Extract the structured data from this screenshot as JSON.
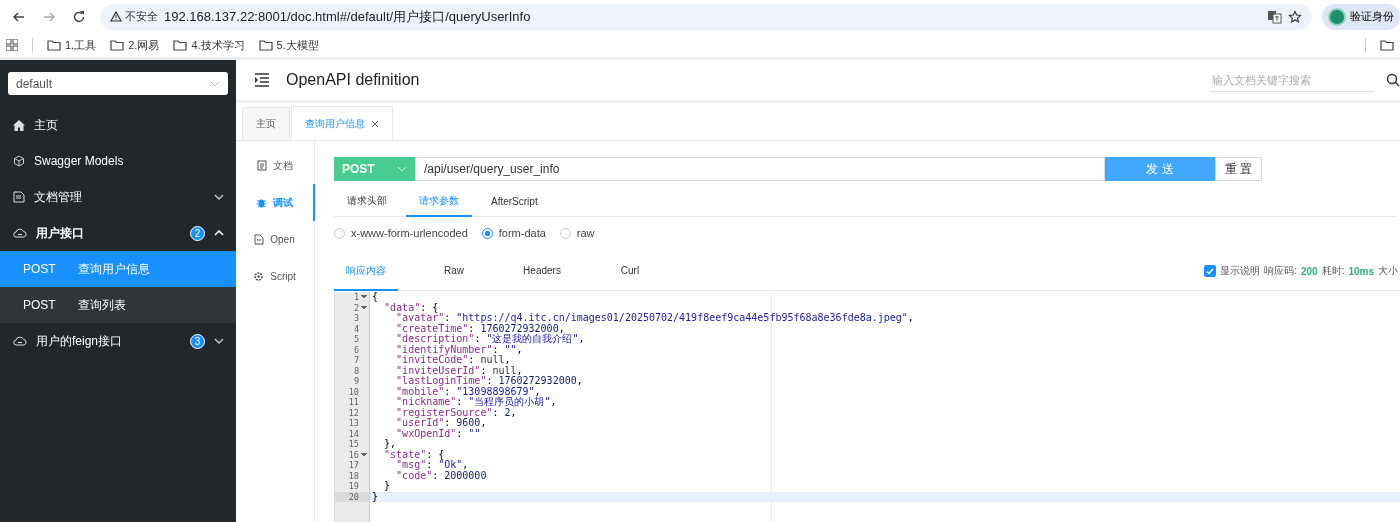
{
  "browser": {
    "security_label": "不安全",
    "url": "192.168.137.22:8001/doc.html#/default/用户接口/queryUserInfo",
    "profile_button": "验证身份",
    "bookmarks": [
      {
        "label": "1.工具"
      },
      {
        "label": "2.网易"
      },
      {
        "label": "4.技术学习"
      },
      {
        "label": "5.大模型"
      }
    ]
  },
  "sidebar": {
    "group_select": "default",
    "items": [
      {
        "kind": "item",
        "label": "主页"
      },
      {
        "kind": "item",
        "label": "Swagger Models"
      },
      {
        "kind": "group",
        "label": "文档管理",
        "expanded": false
      },
      {
        "kind": "group",
        "label": "用户接口",
        "badge": "2",
        "expanded": true,
        "children": [
          {
            "method": "POST",
            "label": "查询用户信息",
            "selected": true
          },
          {
            "method": "POST",
            "label": "查询列表",
            "selected": false
          }
        ]
      },
      {
        "kind": "group",
        "label": "用户的feign接口",
        "badge": "3",
        "expanded": false
      }
    ]
  },
  "header": {
    "title": "OpenAPI definition",
    "search": {
      "placeholder": "输入文档关键字搜索"
    }
  },
  "page_tabs": [
    {
      "label": "主页",
      "selected": false,
      "closable": false
    },
    {
      "label": "查询用户信息",
      "selected": true,
      "closable": true
    }
  ],
  "side_tabs": [
    {
      "label": "文档",
      "selected": false
    },
    {
      "label": "调试",
      "selected": true
    },
    {
      "label": "Open",
      "selected": false
    },
    {
      "label": "Script",
      "selected": false
    }
  ],
  "request": {
    "method": "POST",
    "url": "/api/user/query_user_info",
    "send_button": "发 送",
    "reset_button": "重 置"
  },
  "request_tabs": [
    {
      "label": "请求头部",
      "selected": false
    },
    {
      "label": "请求参数",
      "selected": true
    },
    {
      "label": "AfterScript",
      "selected": false
    }
  ],
  "body_types": [
    {
      "label": "x-www-form-urlencoded",
      "selected": false
    },
    {
      "label": "form-data",
      "selected": true
    },
    {
      "label": "raw",
      "selected": false
    }
  ],
  "response_tabs": [
    {
      "label": "响应内容",
      "selected": true
    },
    {
      "label": "Raw",
      "selected": false
    },
    {
      "label": "Headers",
      "selected": false
    },
    {
      "label": "Curl",
      "selected": false
    }
  ],
  "show_description": {
    "label": "显示说明",
    "checked": true
  },
  "response_status": [
    {
      "label": "响应码:",
      "value": "200"
    },
    {
      "label": "耗时:",
      "value": "10ms"
    },
    {
      "label": "大小"
    }
  ],
  "code_lines": [
    {
      "number": "1",
      "text": "{",
      "foldable": true,
      "active": false
    },
    {
      "number": "2",
      "text": "  \"data\": {",
      "foldable": true,
      "active": false
    },
    {
      "number": "3",
      "text": "    \"avatar\": \"https://q4.itc.cn/images01/20250702/419f8eef9ca44e5fb95f68a8e36fde8a.jpeg\",",
      "foldable": false,
      "active": false
    },
    {
      "number": "4",
      "text": "    \"createTime\": 1760272932000,",
      "foldable": false,
      "active": false
    },
    {
      "number": "5",
      "text": "    \"description\": \"这是我的自我介绍\",",
      "foldable": false,
      "active": false
    },
    {
      "number": "6",
      "text": "    \"identifyNumber\": \"\",",
      "foldable": false,
      "active": false
    },
    {
      "number": "7",
      "text": "    \"inviteCode\": null,",
      "foldable": false,
      "active": false
    },
    {
      "number": "8",
      "text": "    \"inviteUserId\": null,",
      "foldable": false,
      "active": false
    },
    {
      "number": "9",
      "text": "    \"lastLoginTime\": 1760272932000,",
      "foldable": false,
      "active": false
    },
    {
      "number": "10",
      "text": "    \"mobile\": \"13098898679\",",
      "foldable": false,
      "active": false
    },
    {
      "number": "11",
      "text": "    \"nickname\": \"当程序员的小胡\",",
      "foldable": false,
      "active": false
    },
    {
      "number": "12",
      "text": "    \"registerSource\": 2,",
      "foldable": false,
      "active": false
    },
    {
      "number": "13",
      "text": "    \"userId\": 9600,",
      "foldable": false,
      "active": false
    },
    {
      "number": "14",
      "text": "    \"wxOpenId\": \"\"",
      "foldable": false,
      "active": false
    },
    {
      "number": "15",
      "text": "  },",
      "foldable": false,
      "active": false
    },
    {
      "number": "16",
      "text": "  \"state\": {",
      "foldable": true,
      "active": false
    },
    {
      "number": "17",
      "text": "    \"msg\": \"Ok\",",
      "foldable": false,
      "active": false
    },
    {
      "number": "18",
      "text": "    \"code\": 2000000",
      "foldable": false,
      "active": false
    },
    {
      "number": "19",
      "text": "  }",
      "foldable": false,
      "active": false
    },
    {
      "number": "20",
      "text": "}",
      "foldable": false,
      "active": true
    }
  ]
}
